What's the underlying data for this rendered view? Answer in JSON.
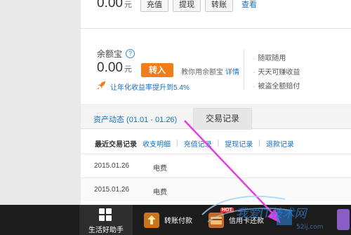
{
  "account": {
    "balance": "0.00",
    "unit": "元",
    "buttons": [
      "充值",
      "提现",
      "转账"
    ],
    "view_link": "查看"
  },
  "yuebao": {
    "title": "余额宝",
    "help_icon": "?",
    "balance": "0.00",
    "unit": "元",
    "transfer_in": "转入",
    "tip": "教你用余额宝",
    "tip_link": "详情",
    "promo": "让年化收益率提升到5.4%",
    "features": [
      "随取随用",
      "天天可赚收益",
      "被盗全额赔付"
    ],
    "accent": "#f07c1c"
  },
  "tabs": {
    "asset_tab": "资产动态 (01.01 - 01.26)",
    "trade_tab": "交易记录"
  },
  "subnav": {
    "current": "最近交易记录",
    "links": [
      "收支明细",
      "充值记录",
      "提现记录",
      "退款记录"
    ]
  },
  "transactions": [
    {
      "date": "2015.01.26",
      "type": "电费"
    },
    {
      "date": "2015.01.26",
      "type": "电费"
    }
  ],
  "taskbar": {
    "home_label": "生活好助手",
    "items": [
      "转账付款",
      "信用卡还款"
    ],
    "hot_badge": "HOT"
  },
  "colors": {
    "link": "#1a6fbf",
    "arrow": "#e83ce6",
    "taskbar_bg": "#1c1c1c"
  }
}
